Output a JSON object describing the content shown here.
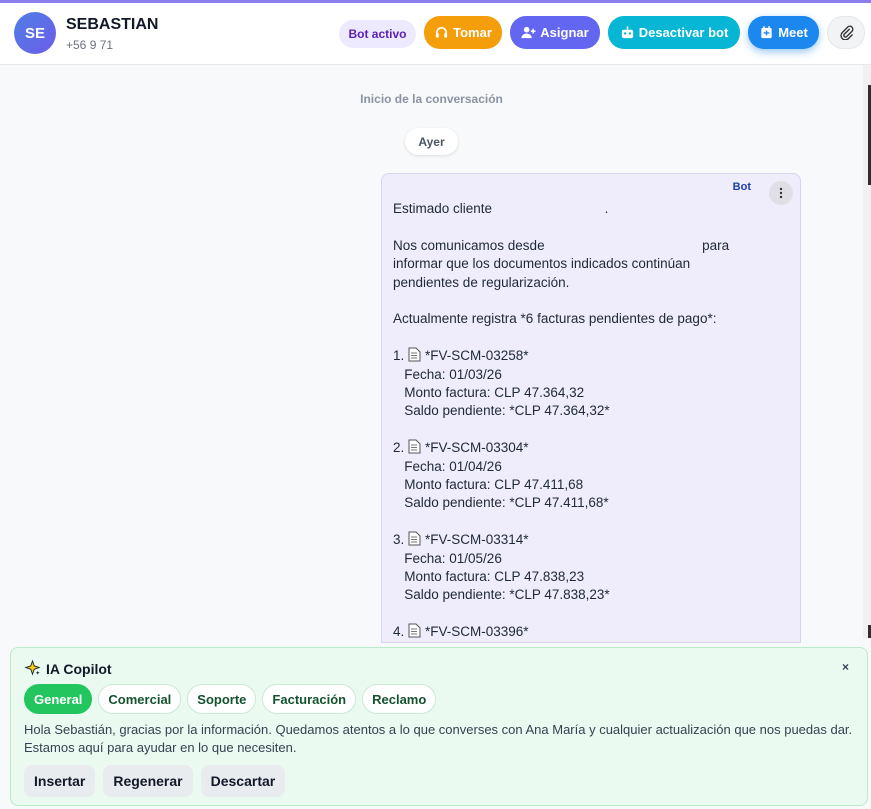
{
  "header": {
    "avatar_initials": "SE",
    "contact_name": "SEBASTIAN",
    "contact_phone": "+56 9 71",
    "status_badge": "Bot activo",
    "buttons": {
      "tomar": "Tomar",
      "asignar": "Asignar",
      "desactivar_bot": "Desactivar bot",
      "meet": "Meet"
    }
  },
  "conversation": {
    "start_label": "Inicio de la conversación",
    "day_divider": "Ayer",
    "message": {
      "sender_tag": "Bot",
      "lines": [
        "Estimado cliente                              .",
        "",
        "Nos comunicamos desde                                          para",
        "informar que los documentos indicados continúan",
        "pendientes de regularización.",
        "",
        "Actualmente registra *6 facturas pendientes de pago*:",
        "",
        "*FV-SCM-03258*",
        "   Fecha: 01/03/26",
        "   Monto factura: CLP 47.364,32",
        "   Saldo pendiente: *CLP 47.364,32*",
        "",
        "*FV-SCM-03304*",
        "   Fecha: 01/04/26",
        "   Monto factura: CLP 47.411,68",
        "   Saldo pendiente: *CLP 47.411,68*",
        "",
        "*FV-SCM-03314*",
        "   Fecha: 01/05/26",
        "   Monto factura: CLP 47.838,23",
        "   Saldo pendiente: *CLP 47.838,23*",
        "",
        "*FV-SCM-03396*"
      ],
      "invoice_prefixes": [
        "1. ",
        "2. ",
        "3. ",
        "4. "
      ]
    }
  },
  "copilot": {
    "title": "IA Copilot",
    "close_label": "×",
    "tabs": [
      "General",
      "Comercial",
      "Soporte",
      "Facturación",
      "Reclamo"
    ],
    "active_tab": "General",
    "suggestion": "Hola Sebastián, gracias por la información. Quedamos atentos a lo que converses con Ana María y cualquier actualización que nos puedas dar. Estamos aquí para ayudar en lo que necesiten.",
    "actions": [
      "Insertar",
      "Regenerar",
      "Descartar"
    ]
  },
  "colors": {
    "tomar": "#f59e0b",
    "asignar": "#6366f1",
    "desactivar_bot": "#06b6d4",
    "meet": "#1d87f0",
    "copilot_active_tab": "#22c55e",
    "bot_bubble": "#efecfb"
  },
  "icons": {
    "tomar": "headset-icon",
    "asignar": "user-plus-icon",
    "desactivar_bot": "robot-icon",
    "meet": "calendar-icon",
    "attach": "paperclip-icon",
    "copilot": "sparkle-icon",
    "invoice": "document-icon"
  }
}
